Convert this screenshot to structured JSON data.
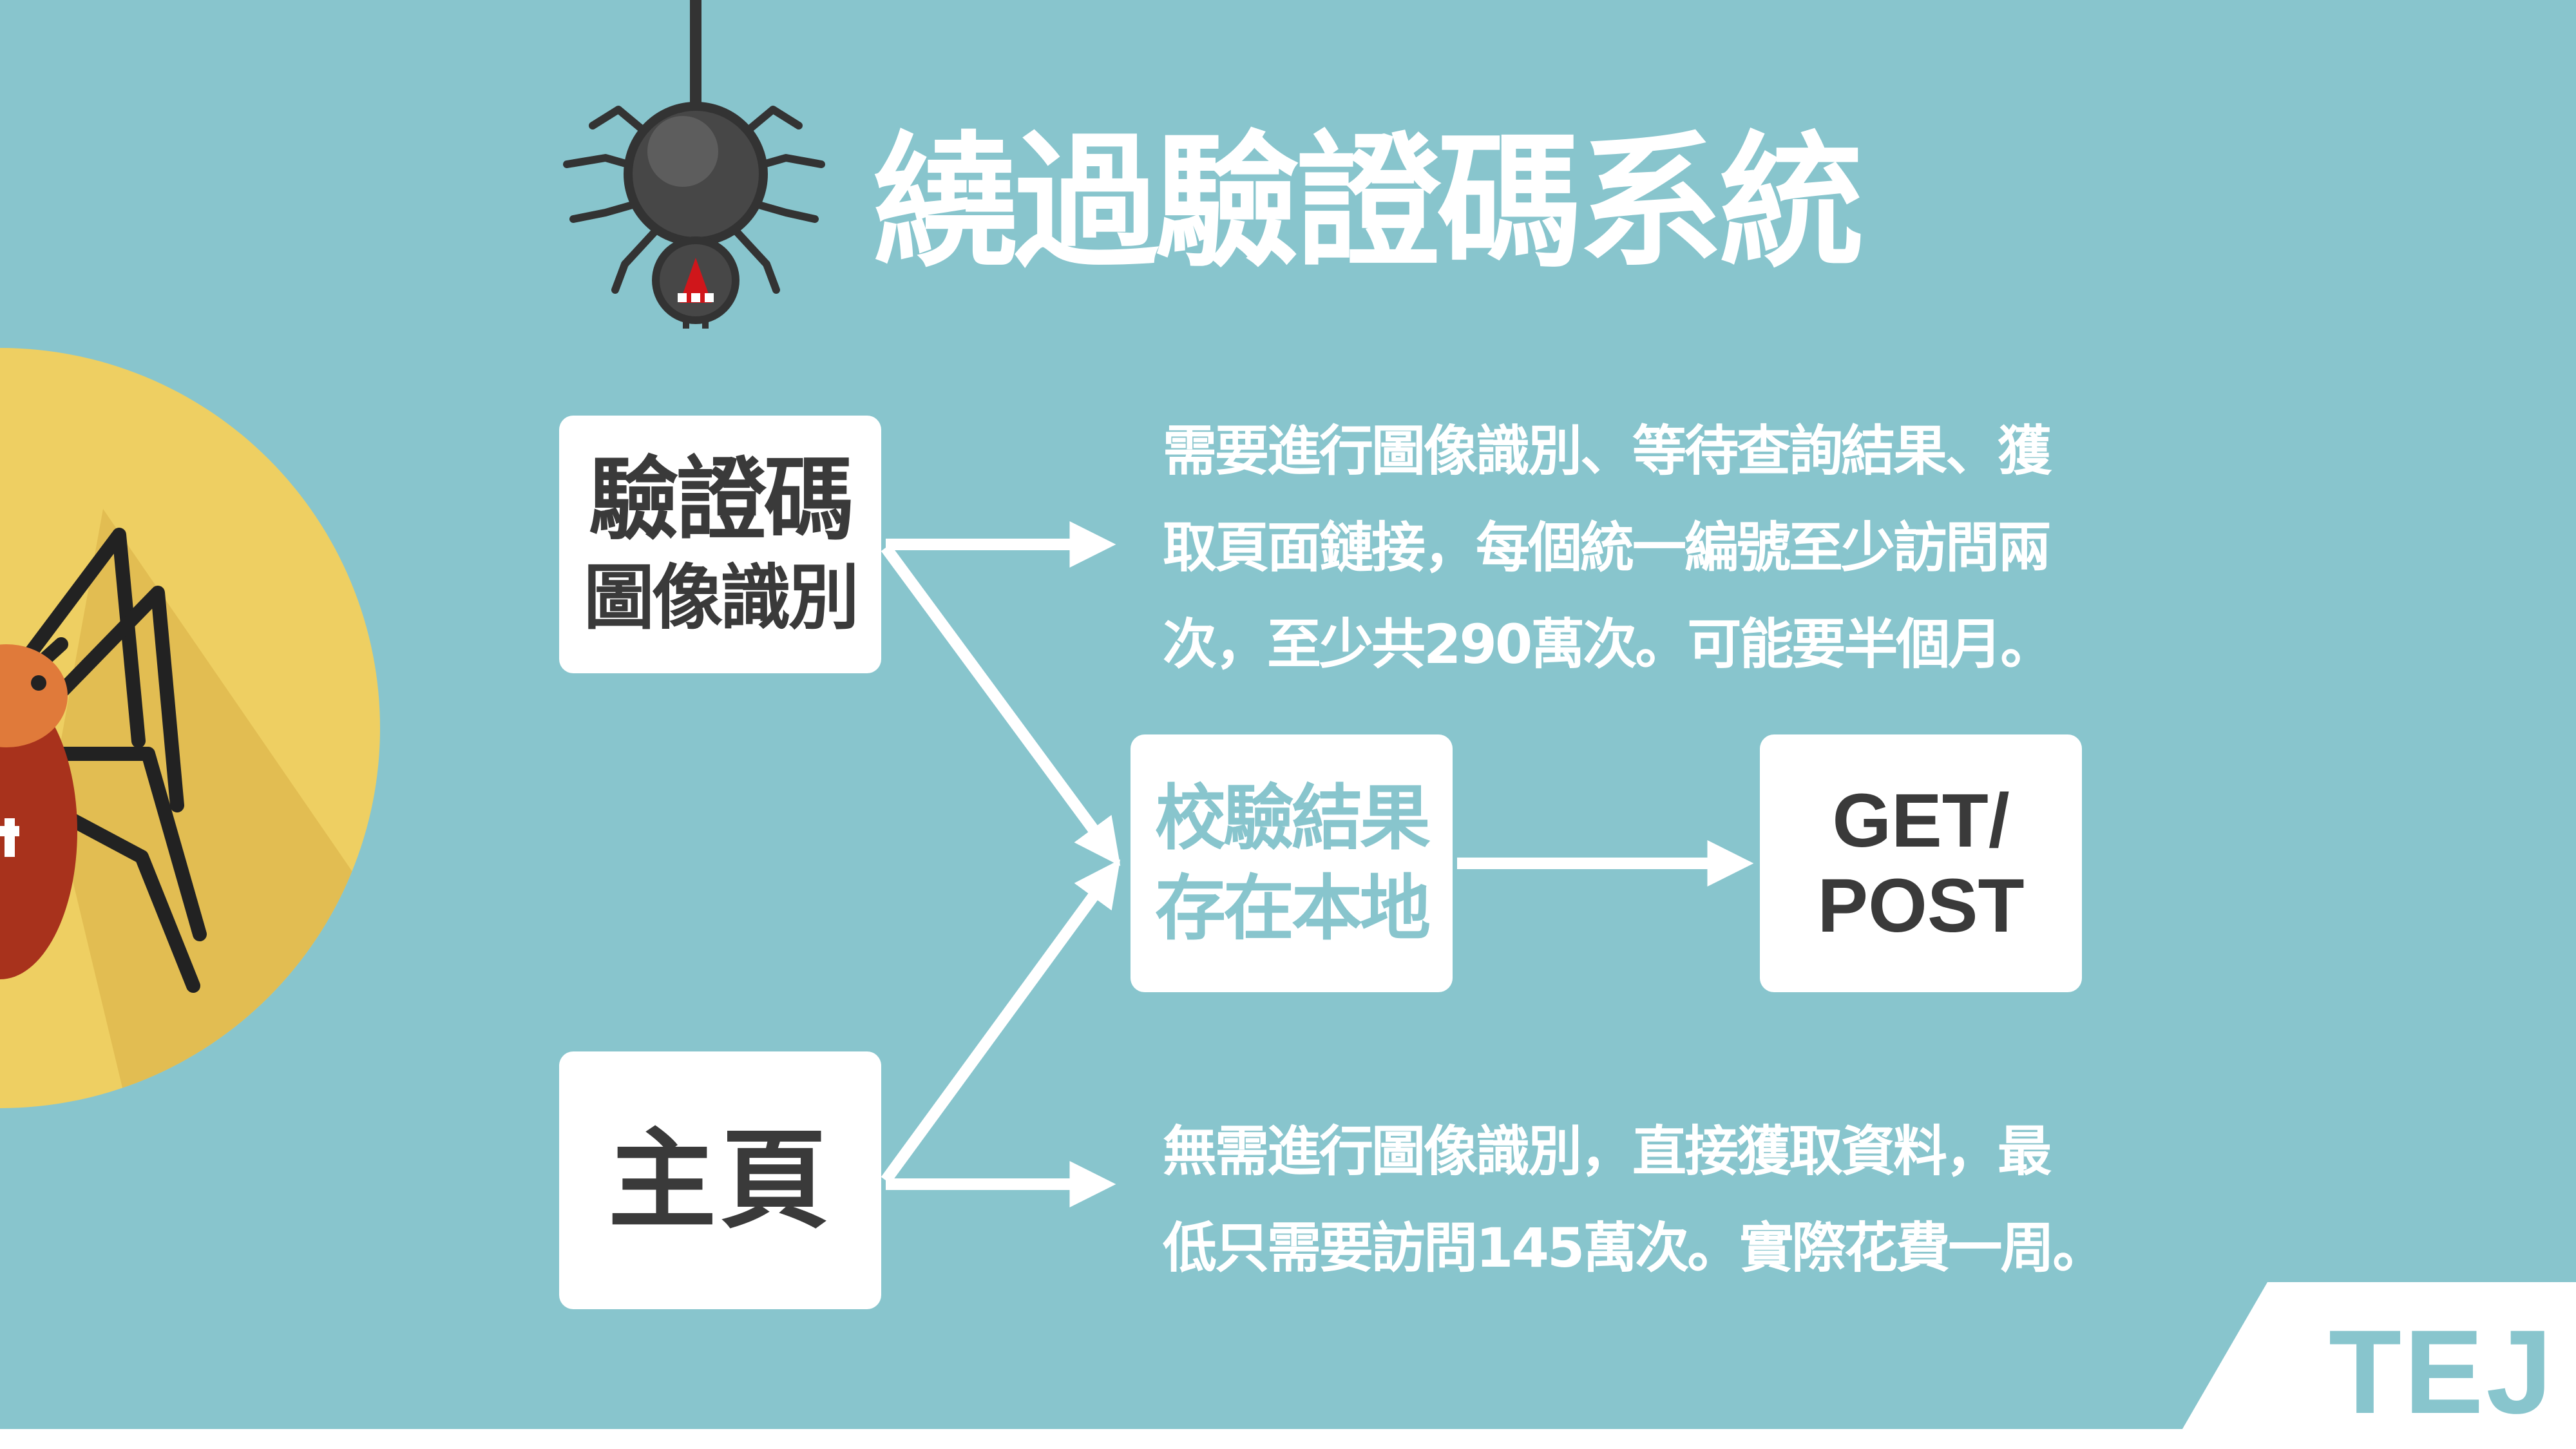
{
  "title": "繞過驗證碼系統",
  "nodes": {
    "captcha": {
      "line1": "驗證碼",
      "line2": "圖像識別"
    },
    "home": {
      "line1": "主頁"
    },
    "verify": {
      "line1": "校驗結果",
      "line2": "存在本地"
    },
    "request": {
      "line1": "GET/",
      "line2": "POST"
    }
  },
  "descriptions": {
    "captcha_path": [
      "需要進行圖像識別、等待查詢結果、獲",
      "取頁面鏈接，每個統一編號至少訪問兩",
      "次，至少共290萬次。可能要半個月。"
    ],
    "home_path": [
      "無需進行圖像識別，直接獲取資料，最",
      "低只需要訪問145萬次。實際花費一周。"
    ]
  },
  "logo": "TEJ",
  "colors": {
    "background": "#88c5cd",
    "box": "#ffffff",
    "text_dark": "#3a3a3a",
    "circle": "#eecf62",
    "spider_body": "#474747",
    "bug_body": "#a8321c",
    "bug_head": "#e07a3a"
  },
  "icons": [
    "hanging-spider-icon",
    "bug-icon"
  ]
}
